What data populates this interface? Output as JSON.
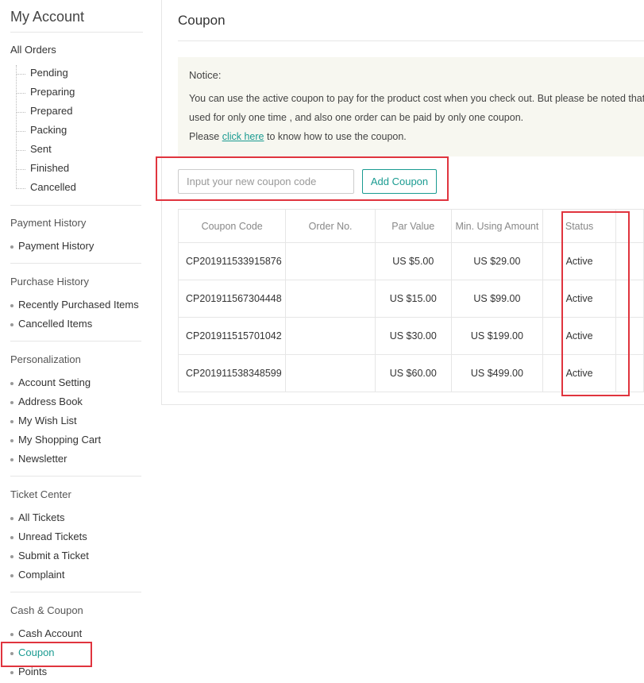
{
  "sidebar": {
    "title": "My Account",
    "all_orders": "All Orders",
    "order_items": [
      "Pending",
      "Preparing",
      "Prepared",
      "Packing",
      "Sent",
      "Finished",
      "Cancelled"
    ],
    "groups": [
      {
        "title": "Payment History",
        "links": [
          "Payment History"
        ]
      },
      {
        "title": "Purchase History",
        "links": [
          "Recently Purchased Items",
          "Cancelled Items"
        ]
      },
      {
        "title": "Personalization",
        "links": [
          "Account Setting",
          "Address Book",
          "My Wish List",
          "My Shopping Cart",
          "Newsletter"
        ]
      },
      {
        "title": "Ticket Center",
        "links": [
          "All Tickets",
          "Unread Tickets",
          "Submit a Ticket",
          "Complaint"
        ]
      },
      {
        "title": "Cash & Coupon",
        "links": [
          "Cash Account",
          "Coupon",
          "Points"
        ]
      }
    ],
    "active_link": "Coupon"
  },
  "main": {
    "title": "Coupon",
    "notice": {
      "title": "Notice:",
      "line1": "You can use the active coupon to pay for the product cost when you check out. But please be noted that",
      "line2": "used for only one time , and also one order can be paid by only one coupon.",
      "line3_prefix": "Please ",
      "link_text": "click here",
      "line3_suffix": " to know how to use the coupon."
    },
    "coupon_input": {
      "placeholder": "Input your new coupon code",
      "value": ""
    },
    "add_button": "Add Coupon",
    "table": {
      "columns": [
        "Coupon Code",
        "Order No.",
        "Par Value",
        "Min. Using Amount",
        "Status"
      ],
      "rows": [
        [
          "CP201911533915876",
          "",
          "US $5.00",
          "US $29.00",
          "Active"
        ],
        [
          "CP201911567304448",
          "",
          "US $15.00",
          "US $99.00",
          "Active"
        ],
        [
          "CP201911515701042",
          "",
          "US $30.00",
          "US $199.00",
          "Active"
        ],
        [
          "CP201911538348599",
          "",
          "US $60.00",
          "US $499.00",
          "Active"
        ]
      ]
    }
  },
  "colors": {
    "accent": "#1a9b91",
    "highlight": "#e0343e",
    "notice_bg": "#f7f7f0"
  }
}
